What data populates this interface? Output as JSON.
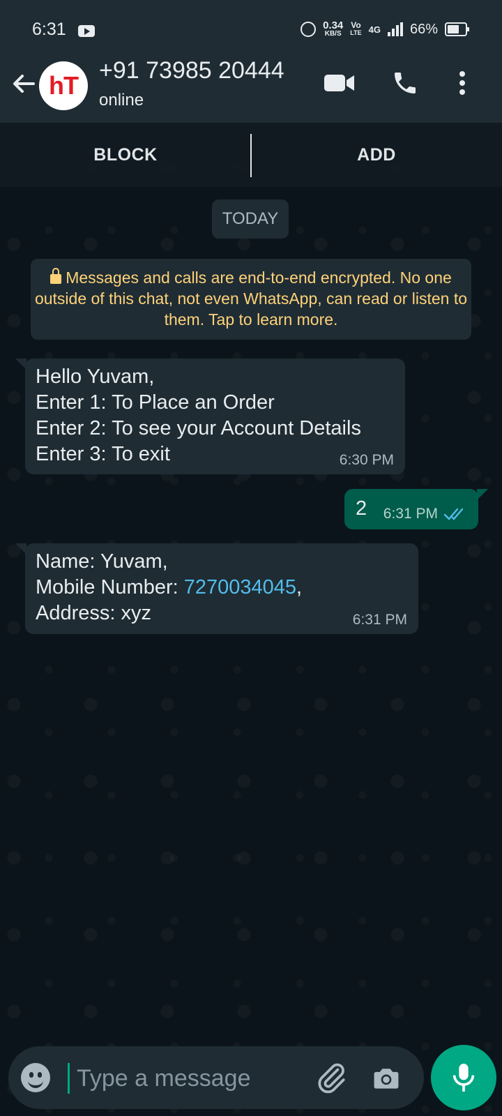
{
  "status_bar": {
    "time": "6:31",
    "net_speed_value": "0.34",
    "net_speed_unit": "KB/S",
    "volte_top": "Vo",
    "volte_bottom": "LTE",
    "network": "4G",
    "battery": "66%"
  },
  "header": {
    "avatar_text": "hT",
    "contact_name": "+91 73985 20444",
    "contact_status": "online"
  },
  "actions": {
    "block_label": "BLOCK",
    "add_label": "ADD"
  },
  "chat": {
    "date_chip": "TODAY",
    "encryption_notice": "Messages and calls are end-to-end encrypted. No one outside of this chat, not even WhatsApp, can read or listen to them. Tap to learn more.",
    "messages": [
      {
        "direction": "incoming",
        "lines": [
          "Hello Yuvam,",
          "Enter 1: To Place an Order",
          "Enter 2: To see your Account Details",
          "Enter 3: To exit"
        ],
        "time": "6:30 PM"
      },
      {
        "direction": "outgoing",
        "text": "2",
        "time": "6:31 PM",
        "read": true
      },
      {
        "direction": "incoming",
        "name_line": "Name: Yuvam,",
        "mobile_prefix": "Mobile Number: ",
        "mobile_number": "7270034045",
        "mobile_suffix": ",",
        "address_line": "Address: xyz",
        "time": "6:31 PM"
      }
    ]
  },
  "composer": {
    "placeholder": "Type a message"
  },
  "colors": {
    "header_bg": "#1f2c34",
    "chat_bg": "#0b141a",
    "incoming_bubble": "#1f2c34",
    "outgoing_bubble": "#005c4b",
    "accent": "#00a884",
    "notice_text": "#ffd279",
    "link": "#53bdeb"
  }
}
